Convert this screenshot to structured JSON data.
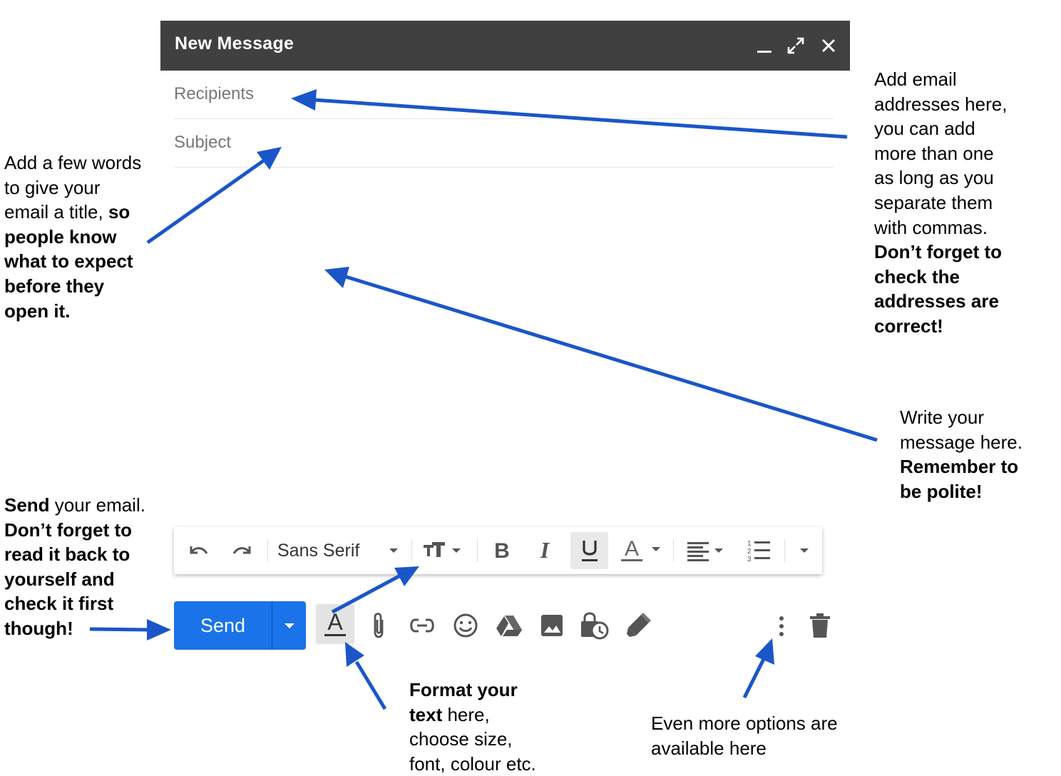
{
  "compose": {
    "title": "New Message",
    "recipients_placeholder": "Recipients",
    "subject_placeholder": "Subject",
    "header_icons": [
      "minimize-icon",
      "expand-icon",
      "close-icon"
    ]
  },
  "toolbar": {
    "font_label": "Sans Serif",
    "icons": [
      "undo-icon",
      "redo-icon",
      "font-dropdown-icon",
      "text-size-icon",
      "bold-icon",
      "italic-icon",
      "underline-icon",
      "text-color-icon",
      "align-icon",
      "numbered-list-icon",
      "more-formatting-icon"
    ]
  },
  "bottom": {
    "send_label": "Send",
    "icons": [
      "formatting-options-icon",
      "attach-icon",
      "link-icon",
      "emoji-icon",
      "drive-icon",
      "photo-icon",
      "confidential-mode-icon",
      "signature-icon",
      "more-options-icon",
      "delete-icon"
    ]
  },
  "colors": {
    "header_bg": "#404040",
    "send_blue": "#1a73e8",
    "arrow_blue": "#1a56c8"
  },
  "annotations": {
    "recipients": {
      "line1": "Add email",
      "line2": "addresses here,",
      "line3": "you can add",
      "line4": "more than one",
      "line5": "as long as you",
      "line6": "separate them",
      "line7": "with commas.",
      "line8": "Don’t forget to",
      "line9": "check the",
      "line10": "addresses are",
      "line11": "correct!"
    },
    "subject": {
      "line1": "Add a few words",
      "line2": "to give your",
      "line3a": "email a title, ",
      "line3b": "so",
      "line4": "people know",
      "line5": "what to expect",
      "line6": "before they",
      "line7": "open it."
    },
    "message": {
      "line1": "Write your",
      "line2": "message here.",
      "line3": "Remember to",
      "line4": "be polite!"
    },
    "send": {
      "line1a": "Send",
      "line1b": " your email.",
      "line2": "Don’t forget to",
      "line3": "read it back to",
      "line4": "yourself and",
      "line5": "check it first",
      "line6": "though!"
    },
    "format": {
      "line1": "Format your",
      "line2a": "text",
      "line2b": " here,",
      "line3": "choose size,",
      "line4": "font, colour etc."
    },
    "more": {
      "line1": "Even more options are",
      "line2": "available here"
    }
  }
}
